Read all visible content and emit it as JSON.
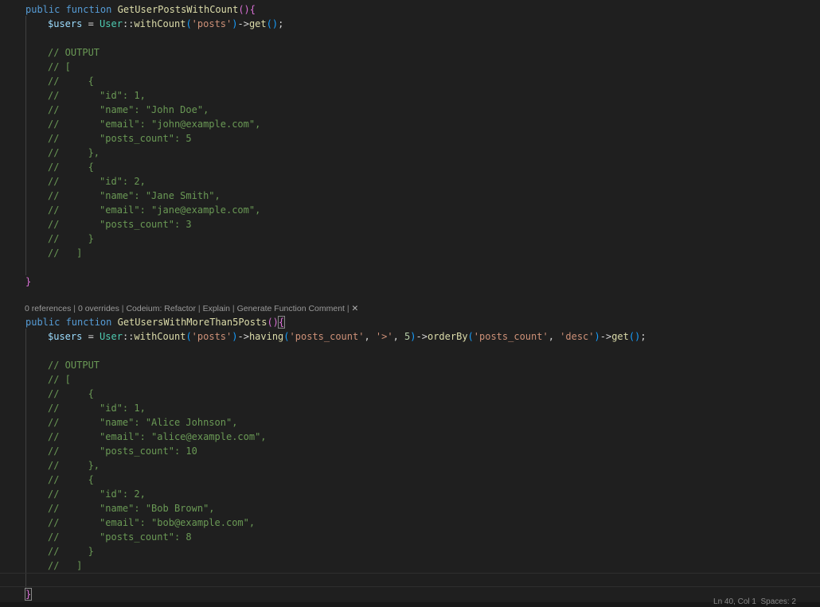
{
  "editor": {
    "function1": {
      "modifiers": "public function",
      "name": "GetUserPostsWithCount",
      "query": {
        "var": "$users",
        "class": "User",
        "method1": "withCount",
        "relation": "'posts'",
        "method2": "get"
      },
      "output_comment": [
        "// OUTPUT",
        "// [",
        "//     {",
        "//       \"id\": 1,",
        "//       \"name\": \"John Doe\",",
        "//       \"email\": \"john@example.com\",",
        "//       \"posts_count\": 5",
        "//     },",
        "//     {",
        "//       \"id\": 2,",
        "//       \"name\": \"Jane Smith\",",
        "//       \"email\": \"jane@example.com\",",
        "//       \"posts_count\": 3",
        "//     }",
        "//   ]"
      ],
      "close_brace": "}"
    },
    "code_lens": {
      "references": "0 references",
      "overrides": "0 overrides",
      "codeium_prefix": "Codeium: Refactor",
      "explain": "Explain",
      "generate": "Generate Function Comment",
      "separator": " | ",
      "close": "✕"
    },
    "function2": {
      "modifiers": "public function",
      "name": "GetUsersWithMoreThan5Posts",
      "query": {
        "var": "$users",
        "class": "User",
        "method1": "withCount",
        "relation": "'posts'",
        "method2": "having",
        "having_col": "'posts_count'",
        "having_op": "'>'",
        "having_val": "5",
        "method3": "orderBy",
        "order_col": "'posts_count'",
        "order_dir": "'desc'",
        "method4": "get"
      },
      "output_comment": [
        "// OUTPUT",
        "// [",
        "//     {",
        "//       \"id\": 1,",
        "//       \"name\": \"Alice Johnson\",",
        "//       \"email\": \"alice@example.com\",",
        "//       \"posts_count\": 10",
        "//     },",
        "//     {",
        "//       \"id\": 2,",
        "//       \"name\": \"Bob Brown\",",
        "//       \"email\": \"bob@example.com\",",
        "//       \"posts_count\": 8",
        "//     }",
        "//   ]"
      ],
      "close_brace": "}"
    },
    "status": {
      "text": "Ln 40, Col 1  Spaces: 2"
    }
  }
}
